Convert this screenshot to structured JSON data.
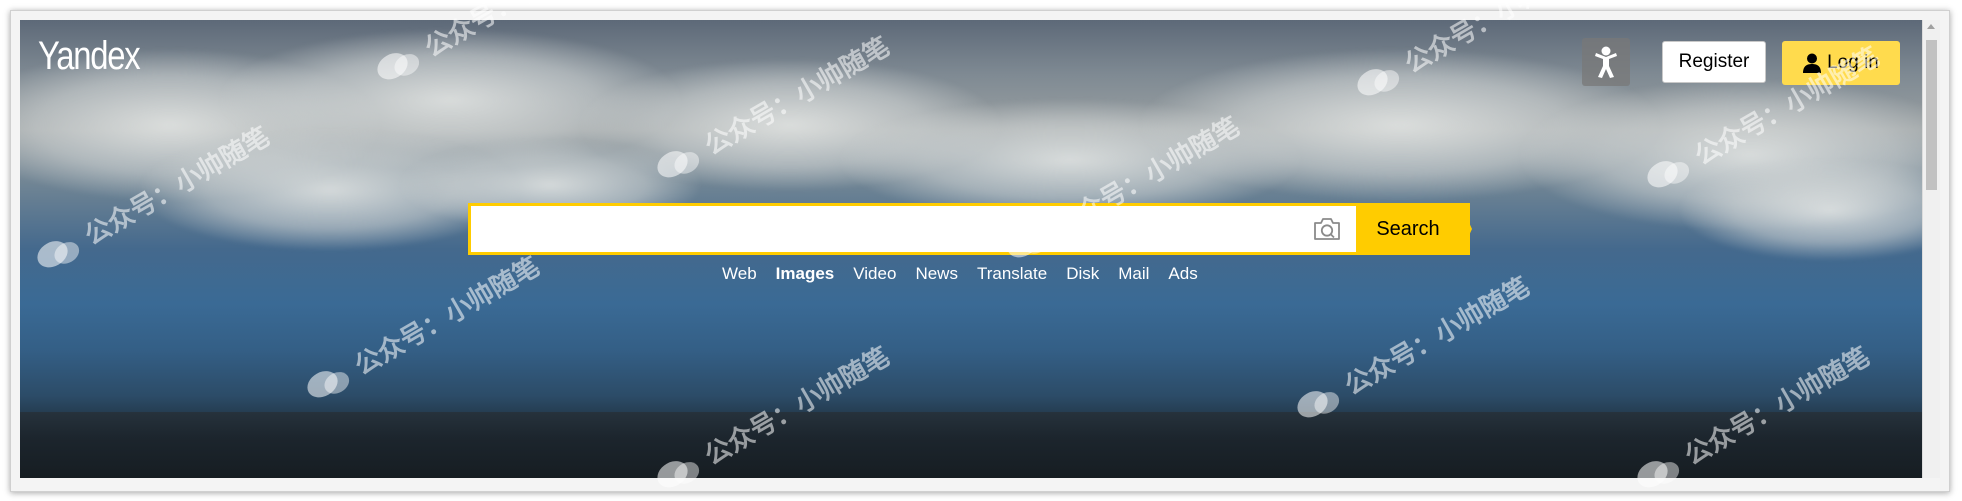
{
  "header": {
    "logo_text": "Yandex",
    "register_label": "Register",
    "login_label": "Log in"
  },
  "search": {
    "input_value": "",
    "placeholder": "",
    "button_label": "Search"
  },
  "services": [
    {
      "label": "Web",
      "active": false
    },
    {
      "label": "Images",
      "active": true
    },
    {
      "label": "Video",
      "active": false
    },
    {
      "label": "News",
      "active": false
    },
    {
      "label": "Translate",
      "active": false
    },
    {
      "label": "Disk",
      "active": false
    },
    {
      "label": "Mail",
      "active": false
    },
    {
      "label": "Ads",
      "active": false
    }
  ],
  "icons": {
    "accessibility": "accessibility-person-icon",
    "camera": "camera-search-icon",
    "user": "user-icon",
    "watermark": "wechat-icon"
  },
  "watermark_text": "公众号：小帅随笔",
  "colors": {
    "accent": "#ffcc00",
    "login_bg": "#ffdb4d",
    "text_on_bg": "#ffffff"
  }
}
